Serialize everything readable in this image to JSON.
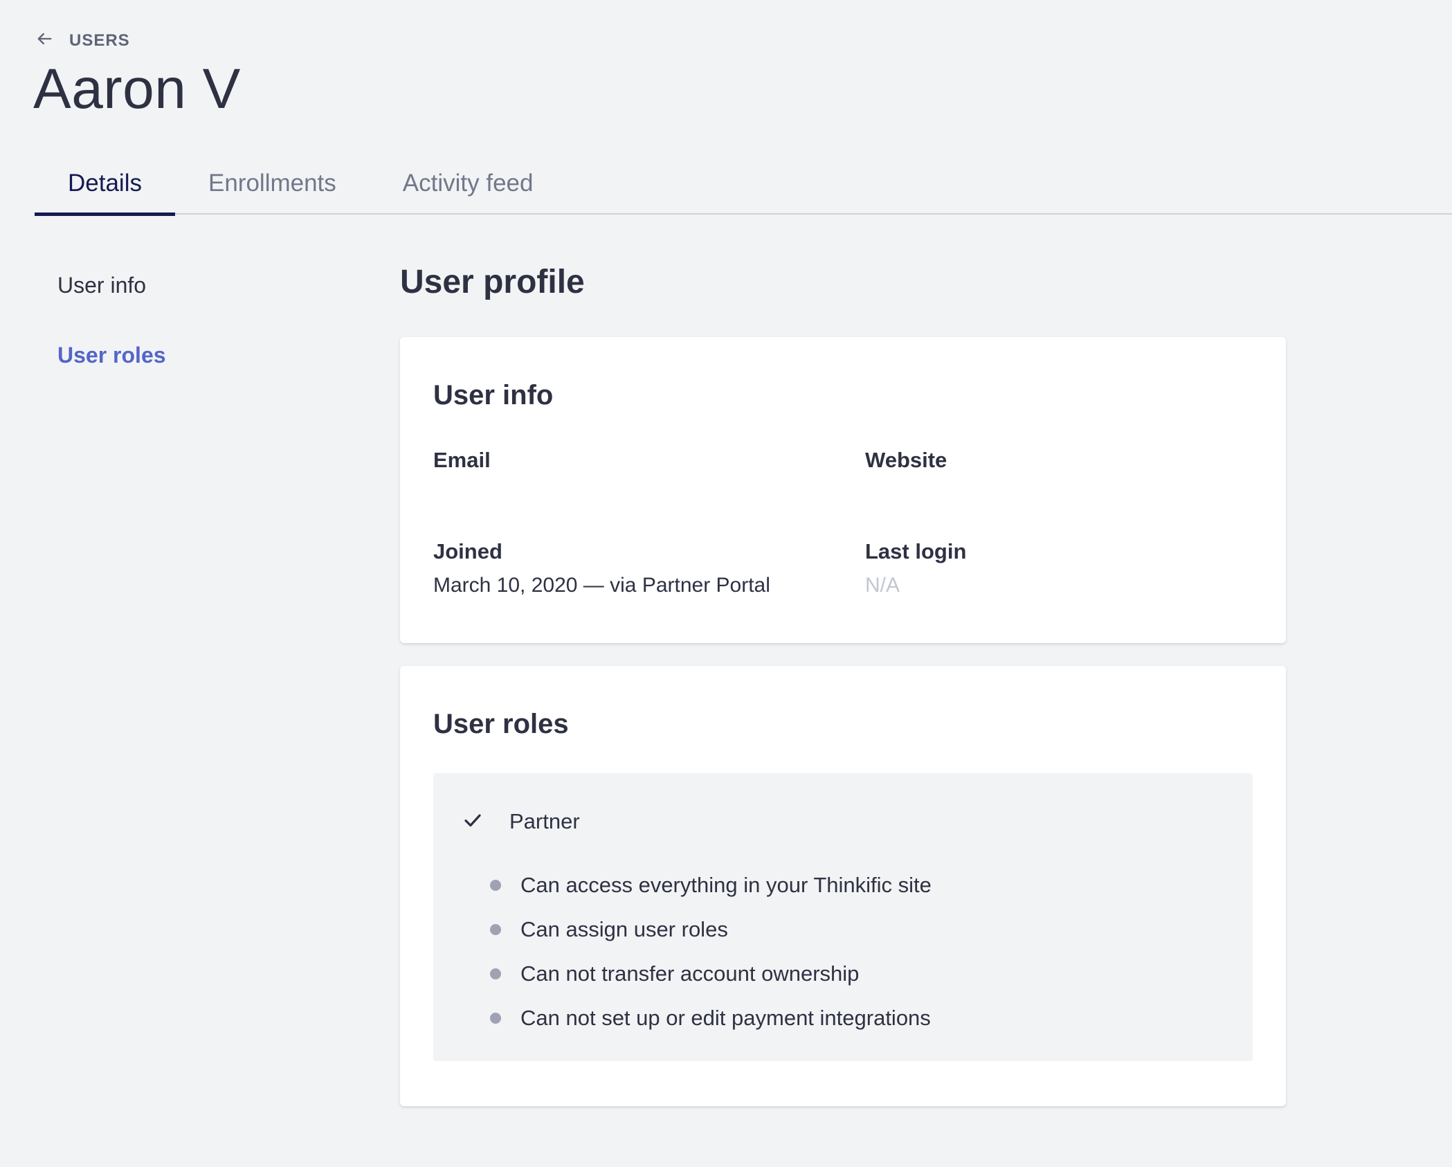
{
  "breadcrumb": {
    "label": "USERS",
    "icon": "arrow-left-icon"
  },
  "page": {
    "title": "Aaron V"
  },
  "tabs": [
    {
      "label": "Details",
      "active": true
    },
    {
      "label": "Enrollments",
      "active": false
    },
    {
      "label": "Activity feed",
      "active": false
    }
  ],
  "side_nav": {
    "items": [
      {
        "label": "User info",
        "active": false
      },
      {
        "label": "User roles",
        "active": true
      }
    ]
  },
  "main": {
    "section_title": "User profile",
    "user_info": {
      "title": "User info",
      "email": {
        "label": "Email",
        "value": ""
      },
      "website": {
        "label": "Website",
        "value": ""
      },
      "joined": {
        "label": "Joined",
        "value": "March 10, 2020 — via Partner Portal"
      },
      "last_login": {
        "label": "Last login",
        "value": "N/A"
      }
    },
    "user_roles": {
      "title": "User roles",
      "role": {
        "name": "Partner",
        "checked": true,
        "permissions": [
          "Can access everything in your Thinkific site",
          "Can assign user roles",
          "Can not transfer account ownership",
          "Can not set up or edit payment integrations"
        ]
      }
    }
  },
  "colors": {
    "background": "#f2f3f5",
    "text": "#2e3142",
    "accent_dark": "#141a52",
    "accent_link": "#5466c6",
    "muted": "#c3c6d0",
    "bullet": "#9ea2b3"
  }
}
